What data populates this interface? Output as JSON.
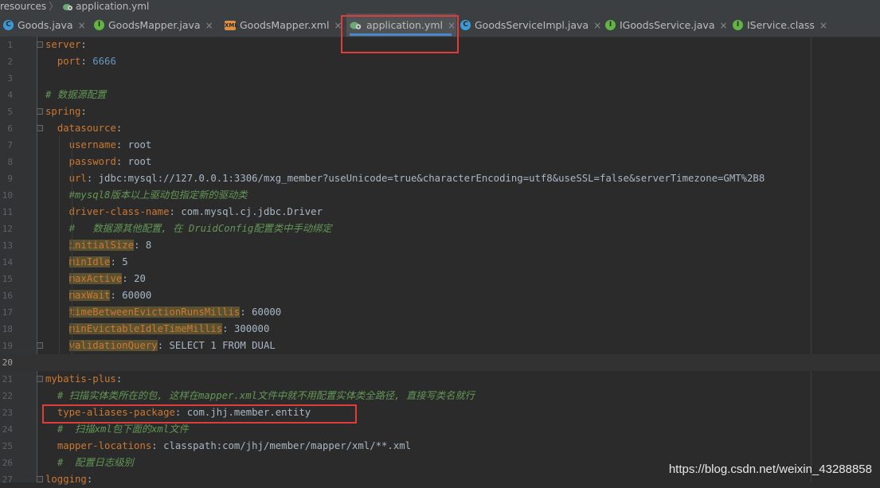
{
  "breadcrumb": {
    "items": [
      "resources",
      "application.yml"
    ],
    "separator": "〉"
  },
  "tabs": [
    {
      "label": "Goods.java",
      "icon": "class-icon",
      "active": false
    },
    {
      "label": "GoodsMapper.java",
      "icon": "interface-icon",
      "active": false
    },
    {
      "label": "GoodsMapper.xml",
      "icon": "xml-icon",
      "active": false
    },
    {
      "label": "application.yml",
      "icon": "spring-yml-icon",
      "active": true
    },
    {
      "label": "GoodsServiceImpl.java",
      "icon": "class-icon",
      "active": false
    },
    {
      "label": "IGoodsService.java",
      "icon": "interface-icon",
      "active": false
    },
    {
      "label": "IService.class",
      "icon": "interface-icon",
      "active": false
    }
  ],
  "close_glyph": "×",
  "lines": [
    {
      "no": "1"
    },
    {
      "no": "2"
    },
    {
      "no": "3"
    },
    {
      "no": "4"
    },
    {
      "no": "5"
    },
    {
      "no": "6"
    },
    {
      "no": "7"
    },
    {
      "no": "8"
    },
    {
      "no": "9"
    },
    {
      "no": "10"
    },
    {
      "no": "11"
    },
    {
      "no": "12"
    },
    {
      "no": "13"
    },
    {
      "no": "14"
    },
    {
      "no": "15"
    },
    {
      "no": "16"
    },
    {
      "no": "17"
    },
    {
      "no": "18"
    },
    {
      "no": "19"
    },
    {
      "no": "20"
    },
    {
      "no": "21"
    },
    {
      "no": "22"
    },
    {
      "no": "23"
    },
    {
      "no": "24"
    },
    {
      "no": "25"
    },
    {
      "no": "26"
    },
    {
      "no": "27"
    }
  ],
  "code": {
    "server": "server",
    "port_key": "port",
    "port_val": "6666",
    "comment_datasource": "# 数据源配置",
    "spring": "spring",
    "datasource": "datasource",
    "username_key": "username",
    "username_val": "root",
    "password_key": "password",
    "password_val": "root",
    "url_key": "url",
    "url_val": "jdbc:mysql://127.0.0.1:3306/mxg_member?useUnicode=true&characterEncoding=utf8&useSSL=false&serverTimezone=GMT%2B8",
    "comment_mysql8": "#mysql8版本以上驱动包指定新的驱动类",
    "driver_key": "driver-class-name",
    "driver_val": "com.mysql.cj.jdbc.Driver",
    "comment_druid": "#   数据源其他配置, 在 DruidConfig配置类中手动绑定",
    "initialSize_key": "initialSize",
    "initialSize_val": "8",
    "minIdle_key": "minIdle",
    "minIdle_val": "5",
    "maxActive_key": "maxActive",
    "maxActive_val": "20",
    "maxWait_key": "maxWait",
    "maxWait_val": "60000",
    "tbe_key": "timeBetweenEvictionRunsMillis",
    "tbe_val": "60000",
    "mei_key": "minEvictableIdleTimeMillis",
    "mei_val": "300000",
    "vq_key": "validationQuery",
    "vq_val": "SELECT 1 FROM DUAL",
    "mybatis": "mybatis-plus",
    "comment_scan": "# 扫描实体类所在的包, 这样在mapper.xml文件中就不用配置实体类全路径, 直接写类名就行",
    "alias_key": "type-aliases-package",
    "alias_val": "com.jhj.member.entity",
    "comment_xml": "#  扫描xml包下面的xml文件",
    "mapper_key": "mapper-locations",
    "mapper_val": "classpath:com/jhj/member/mapper/xml/**.xml",
    "comment_log": "#  配置日志级别",
    "logging": "logging"
  },
  "watermark": "https://blog.csdn.net/weixin_43288858",
  "colors": {
    "background": "#2b2b2b",
    "key": "#cc7832",
    "number": "#6897bb",
    "comment": "#629755",
    "highlight_box": "#e03c3c",
    "active_tab_underline": "#4a88c7"
  }
}
